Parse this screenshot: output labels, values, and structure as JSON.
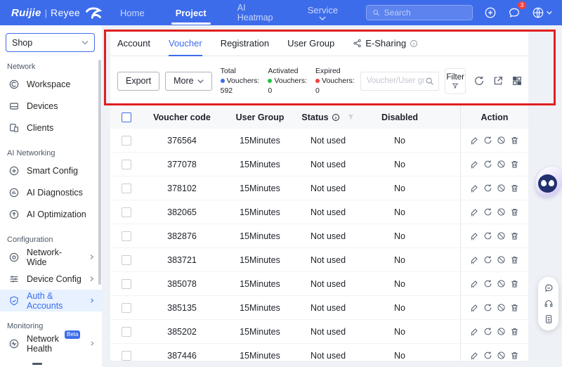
{
  "navbar": {
    "brand": {
      "primary": "Ruijie",
      "divider": "|",
      "secondary": "Reyee"
    },
    "items": [
      {
        "label": "Home"
      },
      {
        "label": "Project"
      },
      {
        "label": "AI Heatmap"
      },
      {
        "label": "Service"
      }
    ],
    "search": {
      "placeholder": "Search"
    },
    "notifications_badge": "3"
  },
  "sidebar": {
    "org_selector": {
      "value": "Shop"
    },
    "sections": [
      {
        "title": "Network",
        "items": [
          {
            "label": "Workspace"
          },
          {
            "label": "Devices"
          },
          {
            "label": "Clients"
          }
        ]
      },
      {
        "title": "AI Networking",
        "items": [
          {
            "label": "Smart Config"
          },
          {
            "label": "AI Diagnostics"
          },
          {
            "label": "AI Optimization"
          }
        ]
      },
      {
        "title": "Configuration",
        "items": [
          {
            "label": "Network-Wide"
          },
          {
            "label": "Device Config"
          },
          {
            "label": "Auth & Accounts"
          }
        ]
      },
      {
        "title": "Monitoring",
        "items": [
          {
            "label": "Network Health",
            "badge": "Beta"
          }
        ]
      }
    ]
  },
  "tabs": [
    {
      "label": "Account"
    },
    {
      "label": "Voucher"
    },
    {
      "label": "Registration"
    },
    {
      "label": "User Group"
    },
    {
      "label": "E-Sharing"
    }
  ],
  "toolbar": {
    "export_label": "Export",
    "more_label": "More",
    "stats": [
      {
        "line1": "Total",
        "line2": "Vouchers:",
        "value": "592",
        "dot_color": "#3d6deb"
      },
      {
        "line1": "Activated",
        "line2": "Vouchers:",
        "value": "0",
        "dot_color": "#23c343"
      },
      {
        "line1": "Expired",
        "line2": "Vouchers:",
        "value": "0",
        "dot_color": "#f53f3f"
      }
    ],
    "search": {
      "placeholder": "Voucher/User group"
    },
    "filter_label": "Filter"
  },
  "table": {
    "headers": {
      "voucher_code": "Voucher code",
      "user_group": "User Group",
      "status": "Status",
      "disabled": "Disabled",
      "action": "Action"
    },
    "rows": [
      {
        "code": "376564",
        "group": "15Minutes",
        "status": "Not used",
        "disabled": "No"
      },
      {
        "code": "377078",
        "group": "15Minutes",
        "status": "Not used",
        "disabled": "No"
      },
      {
        "code": "378102",
        "group": "15Minutes",
        "status": "Not used",
        "disabled": "No"
      },
      {
        "code": "382065",
        "group": "15Minutes",
        "status": "Not used",
        "disabled": "No"
      },
      {
        "code": "382876",
        "group": "15Minutes",
        "status": "Not used",
        "disabled": "No"
      },
      {
        "code": "383721",
        "group": "15Minutes",
        "status": "Not used",
        "disabled": "No"
      },
      {
        "code": "385078",
        "group": "15Minutes",
        "status": "Not used",
        "disabled": "No"
      },
      {
        "code": "385135",
        "group": "15Minutes",
        "status": "Not used",
        "disabled": "No"
      },
      {
        "code": "385202",
        "group": "15Minutes",
        "status": "Not used",
        "disabled": "No"
      },
      {
        "code": "387446",
        "group": "15Minutes",
        "status": "Not used",
        "disabled": "No"
      }
    ]
  },
  "icons": {
    "search-icon": "magnifier",
    "plus-circle-icon": "circled plus",
    "chat-icon": "speech bubble",
    "globe-icon": "globe",
    "caret-down-icon": "chevron down",
    "share-icon": "share nodes",
    "info-icon": "circled i",
    "funnel-icon": "filter funnel",
    "refresh-icon": "circular arrow",
    "export-icon": "square with outgoing arrow",
    "grid-icon": "four squares",
    "edit-icon": "pencil",
    "renew-icon": "circular arrow",
    "ban-icon": "prohibition circle",
    "delete-icon": "trash bin"
  },
  "colors": {
    "navbar_blue": "#3d6ceb",
    "accent_blue": "#3d6deb",
    "active_item_bg": "#e8f1ff",
    "total_dot": "#3d6deb",
    "activated_dot": "#23c343",
    "expired_dot": "#f53f3f",
    "annotation_red": "#e01f1f",
    "badge_red": "#f53f3f",
    "table_header_bg": "#f7f8fa"
  }
}
